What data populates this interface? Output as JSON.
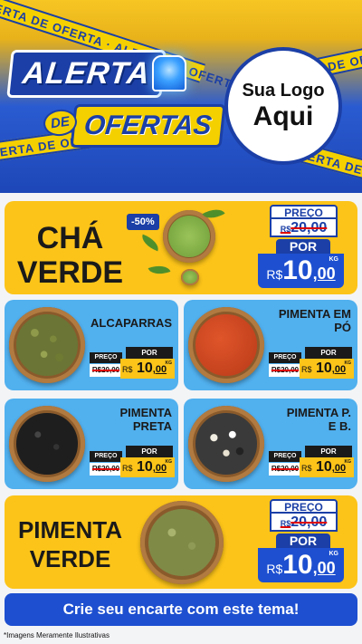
{
  "header": {
    "tape_text": "ALERTA DE OFERTA",
    "alert_word": "ALERTA",
    "de_word": "DE",
    "ofertas_word": "OFERTAS",
    "logo_line1": "Sua Logo",
    "logo_line2": "Aqui"
  },
  "products": [
    {
      "id": "cha-verde",
      "name_line1": "CHÁ",
      "name_line2": "VERDE",
      "discount": "-50%",
      "old_label": "PREÇO",
      "old_cur": "R$",
      "old_price": "20,00",
      "new_label": "POR",
      "currency": "R$",
      "int": "10",
      "dec": ",00",
      "unit": "KG"
    },
    {
      "id": "alcaparras",
      "name_line1": "ALCAPARRAS",
      "name_line2": "",
      "old_label": "PREÇO",
      "old_price": "R$20,00",
      "new_label": "POR",
      "currency": "R$",
      "int": "10",
      "dec": ",00",
      "unit": "KG"
    },
    {
      "id": "pimenta-em-po",
      "name_line1": "PIMENTA EM",
      "name_line2": "PÓ",
      "old_label": "PREÇO",
      "old_price": "R$20,00",
      "new_label": "POR",
      "currency": "R$",
      "int": "10",
      "dec": ",00",
      "unit": "KG"
    },
    {
      "id": "pimenta-preta",
      "name_line1": "PIMENTA",
      "name_line2": "PRETA",
      "old_label": "PREÇO",
      "old_price": "R$20,00",
      "new_label": "POR",
      "currency": "R$",
      "int": "10",
      "dec": ",00",
      "unit": "KG"
    },
    {
      "id": "pimenta-pb",
      "name_line1": "PIMENTA P.",
      "name_line2": "E B.",
      "old_label": "PREÇO",
      "old_price": "R$20,00",
      "new_label": "POR",
      "currency": "R$",
      "int": "10",
      "dec": ",00",
      "unit": "KG"
    },
    {
      "id": "pimenta-verde",
      "name_line1": "PIMENTA",
      "name_line2": "VERDE",
      "old_label": "PREÇO",
      "old_cur": "R$",
      "old_price": "20,00",
      "new_label": "POR",
      "currency": "R$",
      "int": "10",
      "dec": ",00",
      "unit": "KG"
    }
  ],
  "footer": {
    "cta": "Crie seu encarte com este tema!",
    "disclaimer": "*Imagens Meramente Ilustrativas"
  },
  "colors": {
    "yellow": "#fcc419",
    "blue": "#1d4fd0",
    "light_blue": "#51b0ee",
    "navy": "#1b3fa6"
  }
}
